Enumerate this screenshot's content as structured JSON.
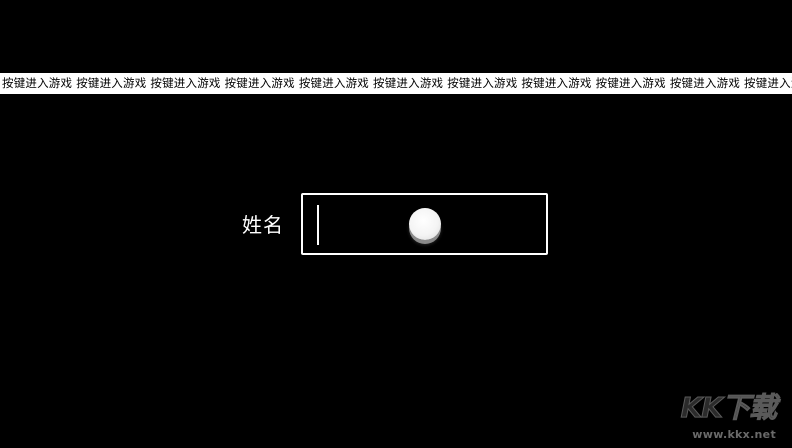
{
  "ticker": {
    "items": [
      "按键进入游戏",
      "按键进入游戏",
      "按键进入游戏",
      "按键进入游戏",
      "按键进入游戏",
      "按键进入游戏",
      "按键进入游戏",
      "按键进入游戏",
      "按键进入游戏",
      "按键进入游戏",
      "按键进入游戏"
    ]
  },
  "name_entry": {
    "label": "姓名",
    "value": ""
  },
  "watermark": {
    "logo_text": "KK下载",
    "url": "www.kkx.net"
  },
  "colors": {
    "background": "#000000",
    "foreground": "#ffffff"
  }
}
